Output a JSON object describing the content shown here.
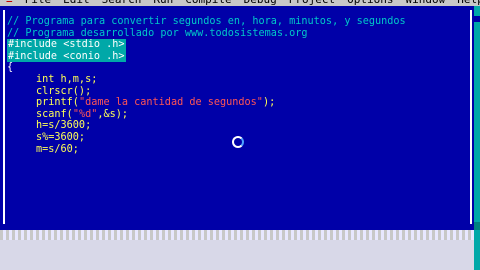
{
  "menu": {
    "items": [
      "≡",
      "File",
      "Edit",
      "Search",
      "Run",
      "Compile",
      "Debug",
      "Project",
      "Options",
      "Window",
      "Help"
    ]
  },
  "editor": {
    "lines": [
      {
        "type": "comment",
        "text": "// Programa para convertir segundos en, hora, minutos, y segundos"
      },
      {
        "type": "comment",
        "text": "// Programa desarrollado por www.todosistemas.org"
      },
      {
        "type": "pre",
        "text": "#include <stdio .h>"
      },
      {
        "type": "pre",
        "text": "#include <conio .h>"
      },
      {
        "type": "normal",
        "text": "{"
      },
      {
        "type": "code",
        "indent": true,
        "parts": [
          {
            "c": "yellow",
            "t": "int h,m,s;"
          }
        ]
      },
      {
        "type": "code",
        "indent": true,
        "parts": [
          {
            "c": "yellow",
            "t": "clrscr();"
          }
        ]
      },
      {
        "type": "code",
        "indent": true,
        "parts": [
          {
            "c": "yellow",
            "t": "printf("
          },
          {
            "c": "str",
            "t": "\"dame la cantidad de segundos\""
          },
          {
            "c": "yellow",
            "t": ");"
          }
        ]
      },
      {
        "type": "code",
        "indent": true,
        "parts": [
          {
            "c": "yellow",
            "t": "scanf("
          },
          {
            "c": "str",
            "t": "\"%d\""
          },
          {
            "c": "yellow",
            "t": ",&s);"
          }
        ]
      },
      {
        "type": "code",
        "indent": true,
        "parts": [
          {
            "c": "yellow",
            "t": "h=s/3600;"
          }
        ]
      },
      {
        "type": "code",
        "indent": true,
        "parts": [
          {
            "c": "yellow",
            "t": "s%=3600;"
          }
        ]
      },
      {
        "type": "code",
        "indent": true,
        "parts": [
          {
            "c": "yellow",
            "t": "m=s/60;"
          }
        ]
      }
    ]
  },
  "colors": {
    "editor_bg": "#0000a8",
    "comment": "#00c8c8",
    "preprocessor_bg": "#00a8a8",
    "string": "#ff5555",
    "keyword": "#ffff55"
  }
}
